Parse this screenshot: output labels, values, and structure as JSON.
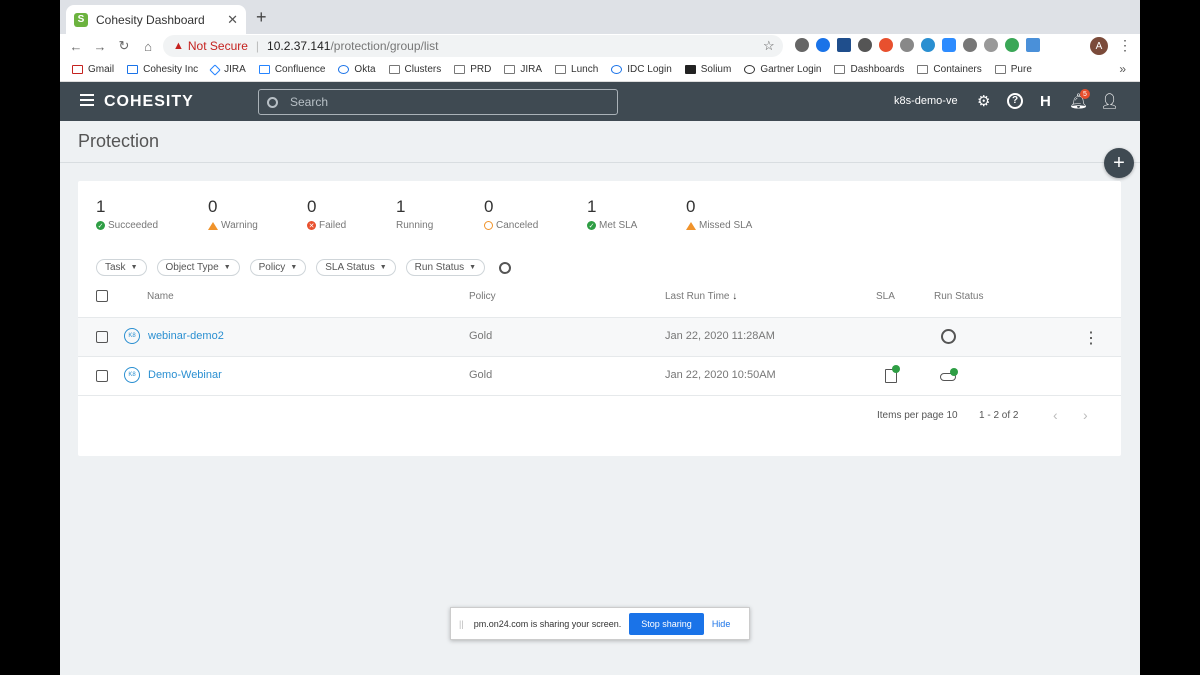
{
  "browser": {
    "tab_title": "Cohesity Dashboard",
    "new_tab": "+",
    "not_secure": "Not Secure",
    "url_host": "10.2.37.141",
    "url_path": "/protection/group/list",
    "profile_initial": "A",
    "bookmarks": [
      "Gmail",
      "Cohesity Inc",
      "JIRA",
      "Confluence",
      "Okta",
      "Clusters",
      "PRD",
      "JIRA",
      "Lunch",
      "IDC Login",
      "Solium",
      "Gartner Login",
      "Dashboards",
      "Containers",
      "Pure"
    ],
    "bookmarks_more": "»"
  },
  "header": {
    "logo": "COHESITY",
    "search_placeholder": "Search",
    "cluster_name": "k8s-demo-ve",
    "notification_count": "5"
  },
  "page": {
    "title": "Protection"
  },
  "stats": [
    {
      "value": "1",
      "label": "Succeeded"
    },
    {
      "value": "0",
      "label": "Warning"
    },
    {
      "value": "0",
      "label": "Failed"
    },
    {
      "value": "1",
      "label": "Running"
    },
    {
      "value": "0",
      "label": "Canceled"
    },
    {
      "value": "1",
      "label": "Met SLA"
    },
    {
      "value": "0",
      "label": "Missed SLA"
    }
  ],
  "filters": [
    "Task",
    "Object Type",
    "Policy",
    "SLA Status",
    "Run Status"
  ],
  "table": {
    "columns": {
      "name": "Name",
      "policy": "Policy",
      "last_run": "Last Run Time",
      "sla": "SLA",
      "run_status": "Run Status"
    },
    "rows": [
      {
        "icon": "K8",
        "name": "webinar-demo2",
        "policy": "Gold",
        "last_run": "Jan 22, 2020 11:28AM"
      },
      {
        "icon": "K8",
        "name": "Demo-Webinar",
        "policy": "Gold",
        "last_run": "Jan 22, 2020 10:50AM"
      }
    ]
  },
  "pagination": {
    "items_per_page_label": "Items per page",
    "items_per_page": "10",
    "range": "1 - 2 of 2"
  },
  "share_bar": {
    "message": "pm.on24.com is sharing your screen.",
    "stop_label": "Stop sharing",
    "hide_label": "Hide"
  },
  "colors": {
    "header_bg": "#3f4a52",
    "link": "#2a8fd1",
    "success": "#2e9e44",
    "warning": "#f0932b",
    "failed": "#e8502e",
    "share_button": "#1a73e8"
  }
}
